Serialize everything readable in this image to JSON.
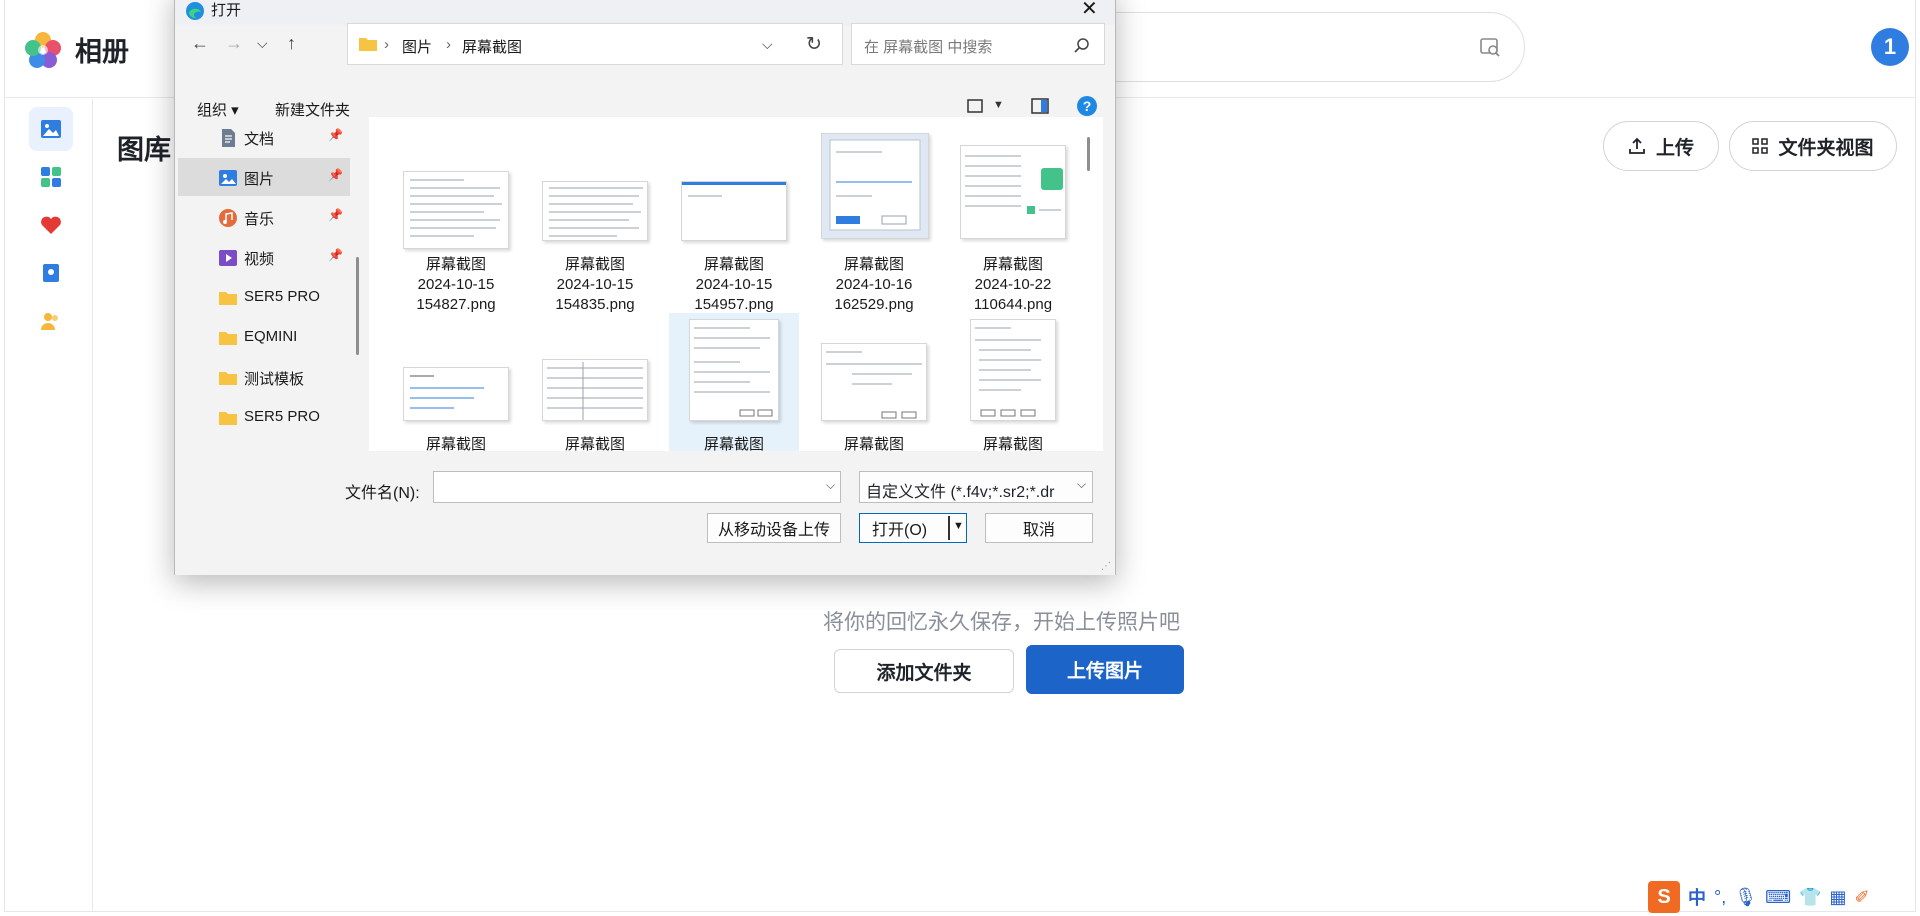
{
  "app": {
    "title": "相册",
    "avatar_letter": "1"
  },
  "page": {
    "title": "图库",
    "upload_label": "上传",
    "folder_view_label": "文件夹视图",
    "empty_message": "将你的回忆永久保存，开始上传照片吧",
    "add_folder_label": "添加文件夹",
    "upload_image_label": "上传图片"
  },
  "dialog": {
    "title": "打开",
    "breadcrumb": [
      "图片",
      "屏幕截图"
    ],
    "search_placeholder": "在 屏幕截图 中搜索",
    "organize_label": "组织 ▾",
    "new_folder_label": "新建文件夹",
    "nav_items": [
      {
        "label": "文档",
        "icon": "document-icon",
        "pinned": true
      },
      {
        "label": "图片",
        "icon": "pictures-icon",
        "pinned": true
      },
      {
        "label": "音乐",
        "icon": "music-icon",
        "pinned": true
      },
      {
        "label": "视频",
        "icon": "video-icon",
        "pinned": true
      },
      {
        "label": "SER5 PRO",
        "icon": "folder-icon",
        "pinned": false
      },
      {
        "label": "EQMINI",
        "icon": "folder-icon",
        "pinned": false
      },
      {
        "label": "测试模板",
        "icon": "folder-icon",
        "pinned": false
      },
      {
        "label": "SER5 PRO",
        "icon": "folder-icon",
        "pinned": false
      }
    ],
    "files": [
      {
        "name": [
          "屏幕截图",
          "2024-10-15",
          "154827.png"
        ]
      },
      {
        "name": [
          "屏幕截图",
          "2024-10-15",
          "154835.png"
        ]
      },
      {
        "name": [
          "屏幕截图",
          "2024-10-15",
          "154957.png"
        ]
      },
      {
        "name": [
          "屏幕截图",
          "2024-10-16",
          "162529.png"
        ]
      },
      {
        "name": [
          "屏幕截图",
          "2024-10-22",
          "110644.png"
        ]
      },
      {
        "name": [
          "屏幕截图"
        ]
      },
      {
        "name": [
          "屏幕截图"
        ]
      },
      {
        "name": [
          "屏幕截图"
        ]
      },
      {
        "name": [
          "屏幕截图"
        ]
      },
      {
        "name": [
          "屏幕截图"
        ]
      }
    ],
    "filename_label": "文件名(N):",
    "filename_value": "",
    "filter_value": "自定义文件 (*.f4v;*.sr2;*.dr",
    "upload_mobile_label": "从移动设备上传",
    "open_label": "打开(O)",
    "cancel_label": "取消"
  },
  "tray": {
    "ime_mode": "中"
  },
  "colors": {
    "accent": "#1d64c8",
    "avatar": "#2f7de1",
    "selection": "#e5f1fb"
  }
}
